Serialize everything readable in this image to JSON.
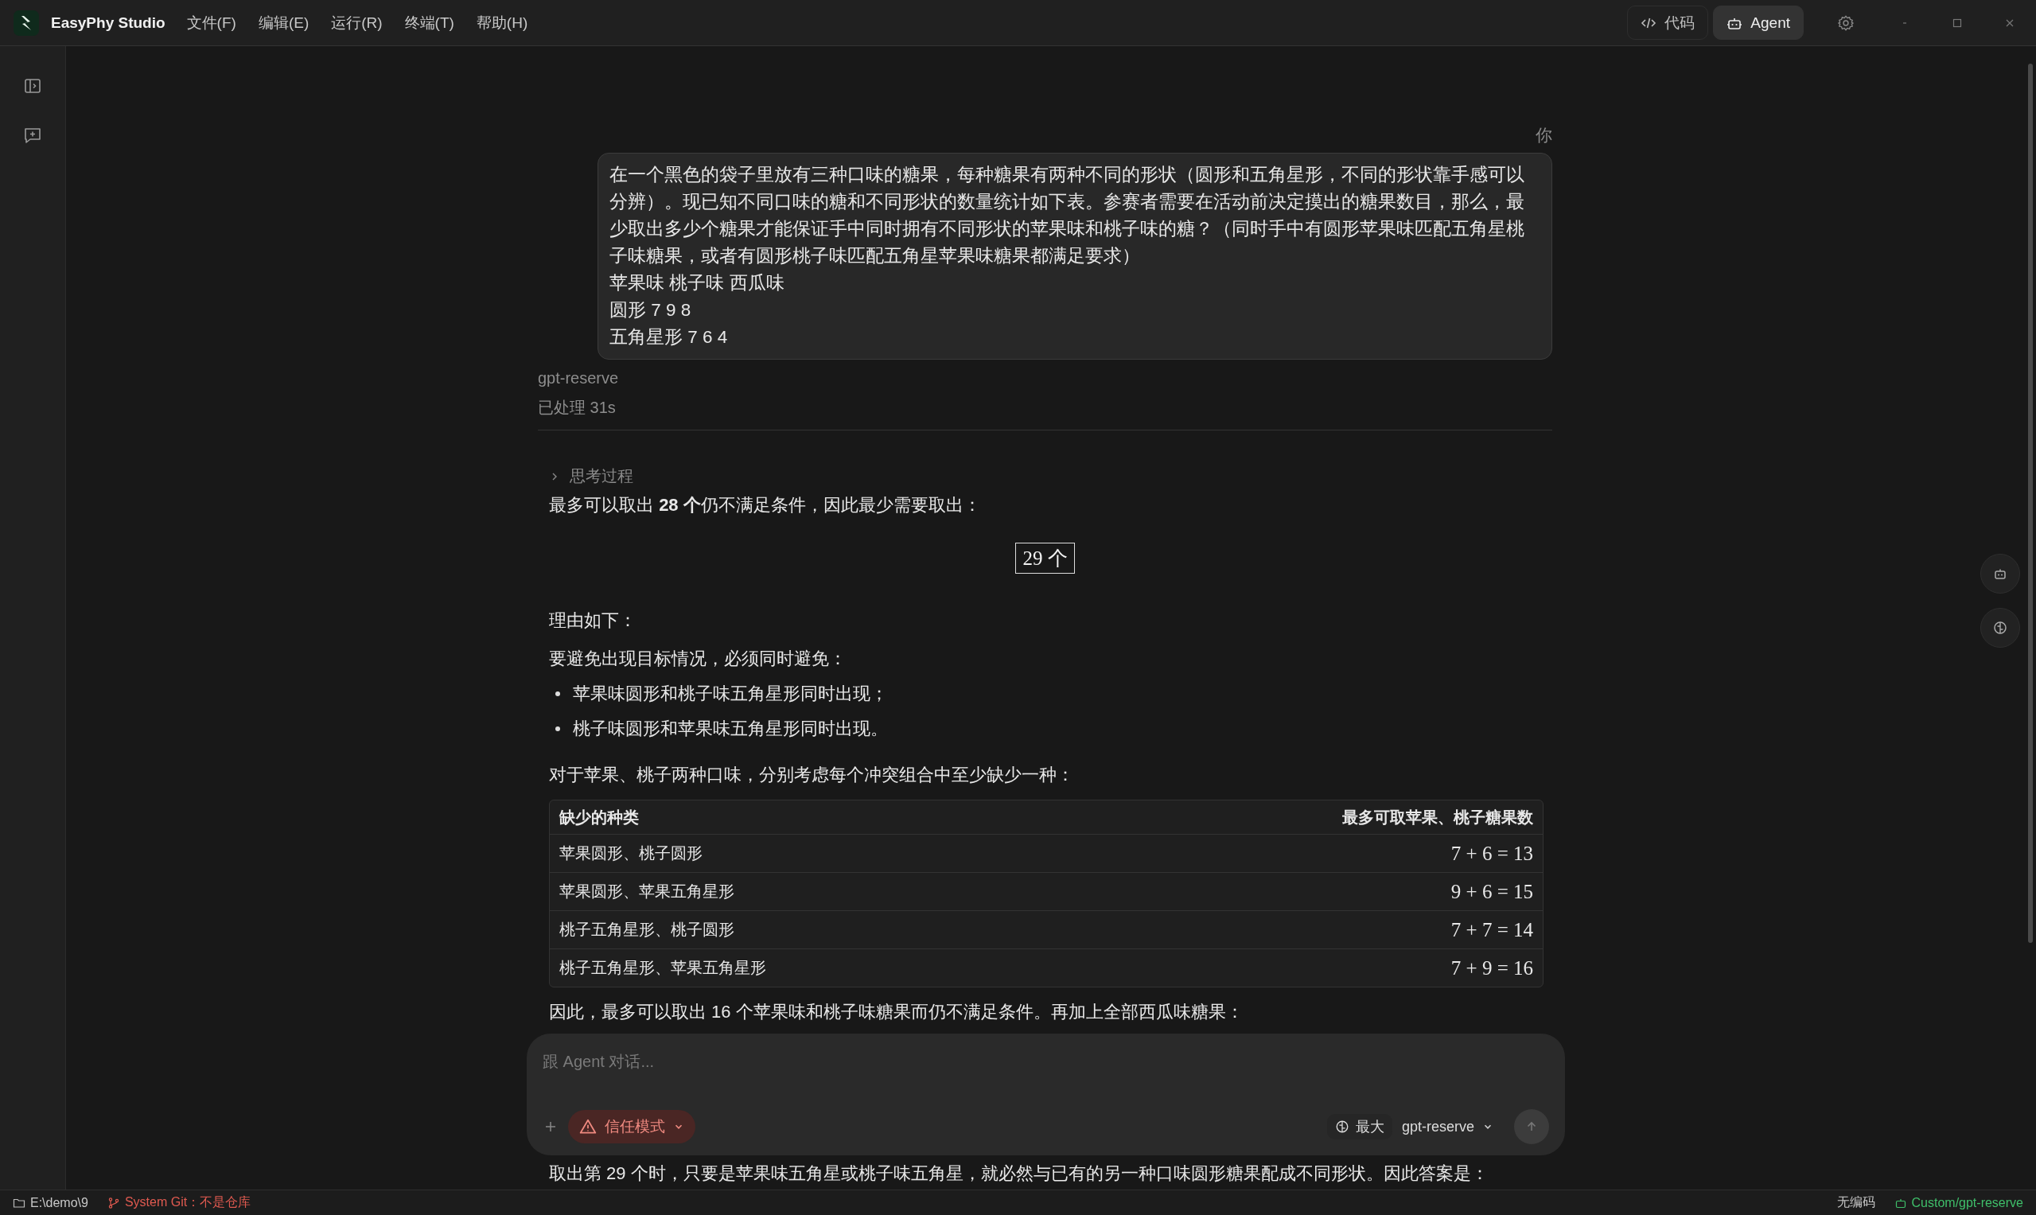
{
  "titlebar": {
    "app_name": "EasyPhy Studio",
    "menu": [
      "文件(F)",
      "编辑(E)",
      "运行(R)",
      "终端(T)",
      "帮助(H)"
    ],
    "mode_tabs": [
      {
        "label": "代码",
        "selected": false,
        "kind": "code"
      },
      {
        "label": "Agent",
        "selected": true,
        "kind": "robot"
      }
    ]
  },
  "conversation": {
    "user_label": "你",
    "user_message_lines": [
      "在一个黑色的袋子里放有三种口味的糖果，每种糖果有两种不同的形状（圆形和五角星形，不同的形状靠手感可以分辨）。现已知不同口味的糖和不同形状的数量统计如下表。参赛者需要在活动前决定摸出的糖果数目，那么，最少取出多少个糖果才能保证手中同时拥有不同形状的苹果味和桃子味的糖？（同时手中有圆形苹果味匹配五角星桃子味糖果，或者有圆形桃子味匹配五角星苹果味糖果都满足要求）",
      "苹果味 桃子味 西瓜味",
      "圆形 7 9 8",
      "五角星形 7 6 4"
    ],
    "model": "gpt-reserve",
    "elapsed": "已处理 31s",
    "thinking": {
      "label": "思考过程",
      "expanded": false
    },
    "blocks": [
      {
        "kind": "paragraph",
        "text": "最多可以取出 **28 个**仍不满足条件，因此最少需要取出："
      },
      {
        "kind": "answer_box",
        "text": "29 个"
      },
      {
        "kind": "paragraph",
        "text": "理由如下："
      },
      {
        "kind": "paragraph",
        "text": "要避免出现目标情况，必须同时避免："
      },
      {
        "kind": "bullets",
        "items": [
          "苹果味圆形和桃子味五角星形同时出现；",
          "桃子味圆形和苹果味五角星形同时出现。"
        ]
      },
      {
        "kind": "paragraph",
        "text": "对于苹果、桃子两种口味，分别考虑每个冲突组合中至少缺少一种："
      },
      {
        "kind": "table",
        "columns": [
          "缺少的种类",
          "最多可取苹果、桃子糖果数"
        ],
        "rows": [
          [
            "苹果圆形、桃子圆形",
            "7 + 6 = 13"
          ],
          [
            "苹果圆形、苹果五角星形",
            "9 + 6 = 15"
          ],
          [
            "桃子五角星形、桃子圆形",
            "7 + 7 = 14"
          ],
          [
            "桃子五角星形、苹果五角星形",
            "7 + 9 = 16"
          ]
        ]
      },
      {
        "kind": "paragraph",
        "text": "因此，最多可以取出 16 个苹果味和桃子味糖果而仍不满足条件。再加上全部西瓜味糖果："
      }
    ],
    "after_composer": "取出第 29 个时，只要是苹果味五角星或桃子味五角星，就必然与已有的另一种口味圆形糖果配成不同形状。因此答案是："
  },
  "composer": {
    "placeholder": "跟 Agent 对话...",
    "trust_mode": "信任模式",
    "effort": "最大",
    "model": "gpt-reserve"
  },
  "status_bar": {
    "path": "E:\\demo\\9",
    "git": "System Git：不是仓库",
    "encoding": "无编码",
    "agent": "Custom/gpt-reserve"
  }
}
